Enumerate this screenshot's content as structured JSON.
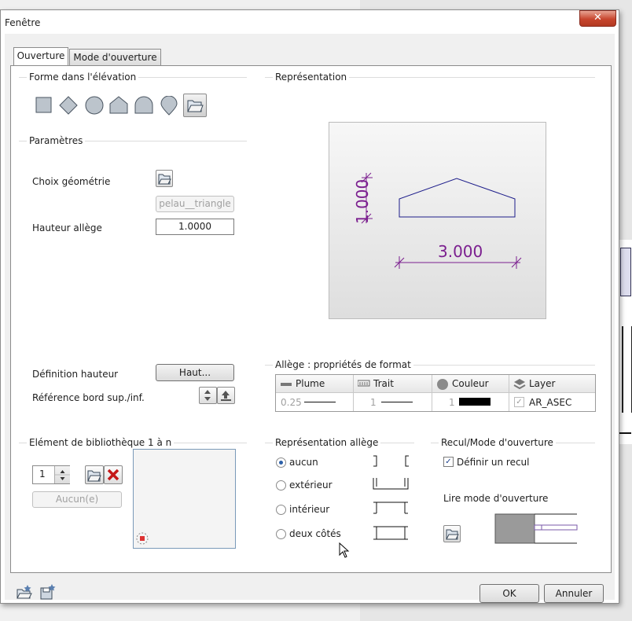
{
  "window": {
    "title": "Fenêtre",
    "close_label": "✕"
  },
  "tabs": [
    {
      "label": "Ouverture"
    },
    {
      "label": "Mode d'ouverture"
    }
  ],
  "forme": {
    "legend": "Forme dans l'élévation"
  },
  "parametres": {
    "legend": "Paramètres",
    "choix_label": "Choix géométrie",
    "geometry_value": "pelau__triangle",
    "hauteur_label": "Hauteur allège",
    "hauteur_value": "1.0000",
    "def_hauteur_label": "Définition hauteur",
    "haut_button": "Haut...",
    "ref_label": "Référence bord sup./inf."
  },
  "representation": {
    "legend": "Représentation",
    "dim_height": "1.000",
    "dim_width": "3.000"
  },
  "allege_props": {
    "legend": "Allège : propriétés de format",
    "headers": {
      "plume": "Plume",
      "trait": "Trait",
      "couleur": "Couleur",
      "layer": "Layer"
    },
    "values": {
      "plume": "0.25",
      "trait": "1",
      "couleur": "1",
      "layer": "AR_ASEC"
    }
  },
  "library": {
    "legend": "Elément de bibliothèque 1 à n",
    "spinner_value": "1",
    "aucun_button": "Aucun(e)"
  },
  "rep_allege": {
    "legend": "Représentation allège",
    "options": [
      {
        "label": "aucun",
        "selected": true
      },
      {
        "label": "extérieur",
        "selected": false
      },
      {
        "label": "intérieur",
        "selected": false
      },
      {
        "label": "deux côtés",
        "selected": false
      }
    ]
  },
  "recul": {
    "legend": "Recul/Mode d'ouverture",
    "definir_label": "Définir un recul",
    "definir_checked": true,
    "lire_label": "Lire mode d'ouverture"
  },
  "footer": {
    "ok_label": "OK",
    "cancel_label": "Annuler"
  },
  "colors": {
    "dimension": "#7b1f8f",
    "shape_line": "#1c1c8a",
    "accent": "#2b5fa8"
  }
}
